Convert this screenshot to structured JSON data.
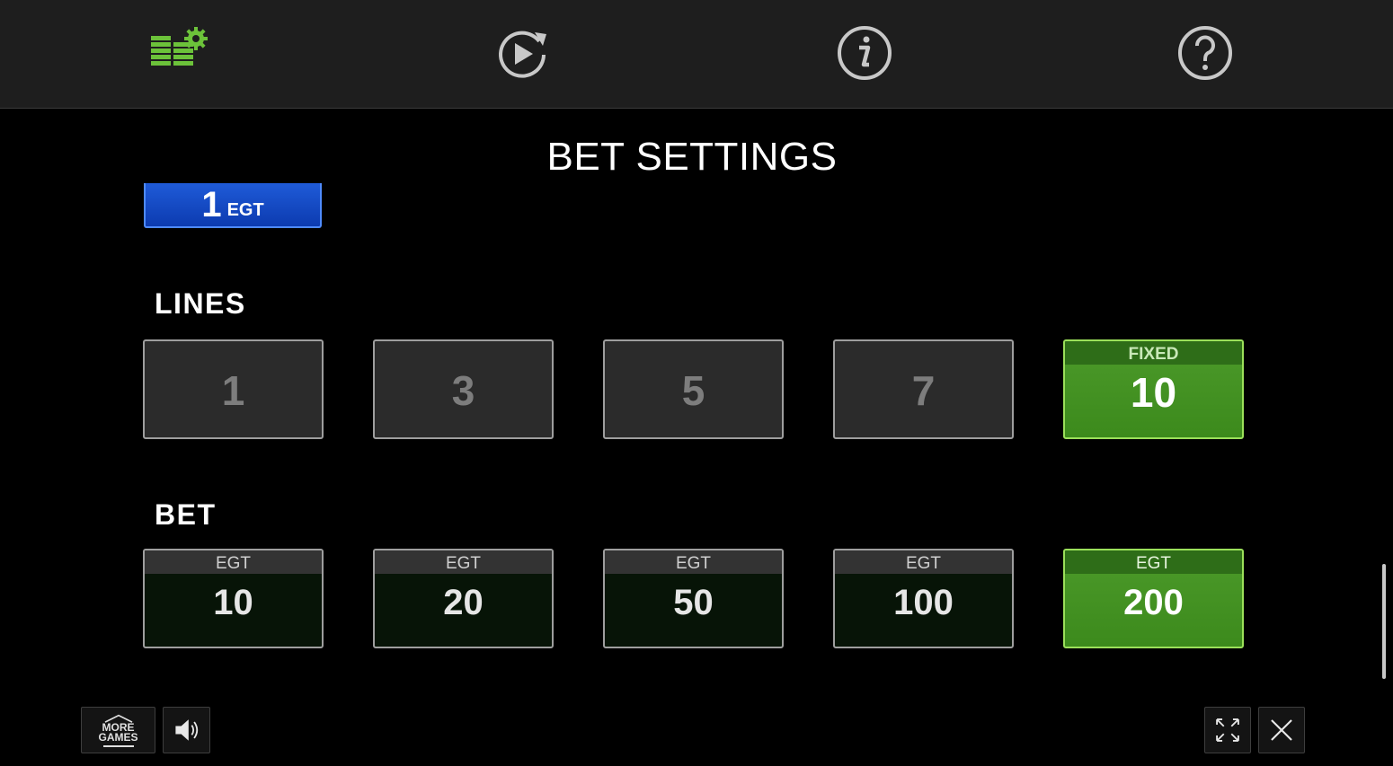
{
  "nav": {
    "settings_icon": "bet-settings-icon",
    "autoplay_icon": "autoplay-icon",
    "info_icon": "info-icon",
    "help_icon": "help-icon",
    "active_color": "#6cc23a"
  },
  "title": "BET SETTINGS",
  "denomination": {
    "value": "1",
    "currency": "EGT"
  },
  "lines": {
    "label": "LINES",
    "options": [
      "1",
      "3",
      "5",
      "7",
      "10"
    ],
    "selected_header": "FIXED",
    "selected_value": "10"
  },
  "bet": {
    "label": "BET",
    "currency": "EGT",
    "options": [
      "10",
      "20",
      "50",
      "100",
      "200"
    ],
    "selected_value": "200"
  },
  "footer": {
    "more_games_line1": "MORE",
    "more_games_line2": "GAMES",
    "sound_icon": "speaker-icon",
    "fullscreen_icon": "fullscreen-icon",
    "close_icon": "close-icon"
  },
  "colors": {
    "active_green": "#4c9a2a",
    "denom_blue": "#1f5bd8"
  }
}
